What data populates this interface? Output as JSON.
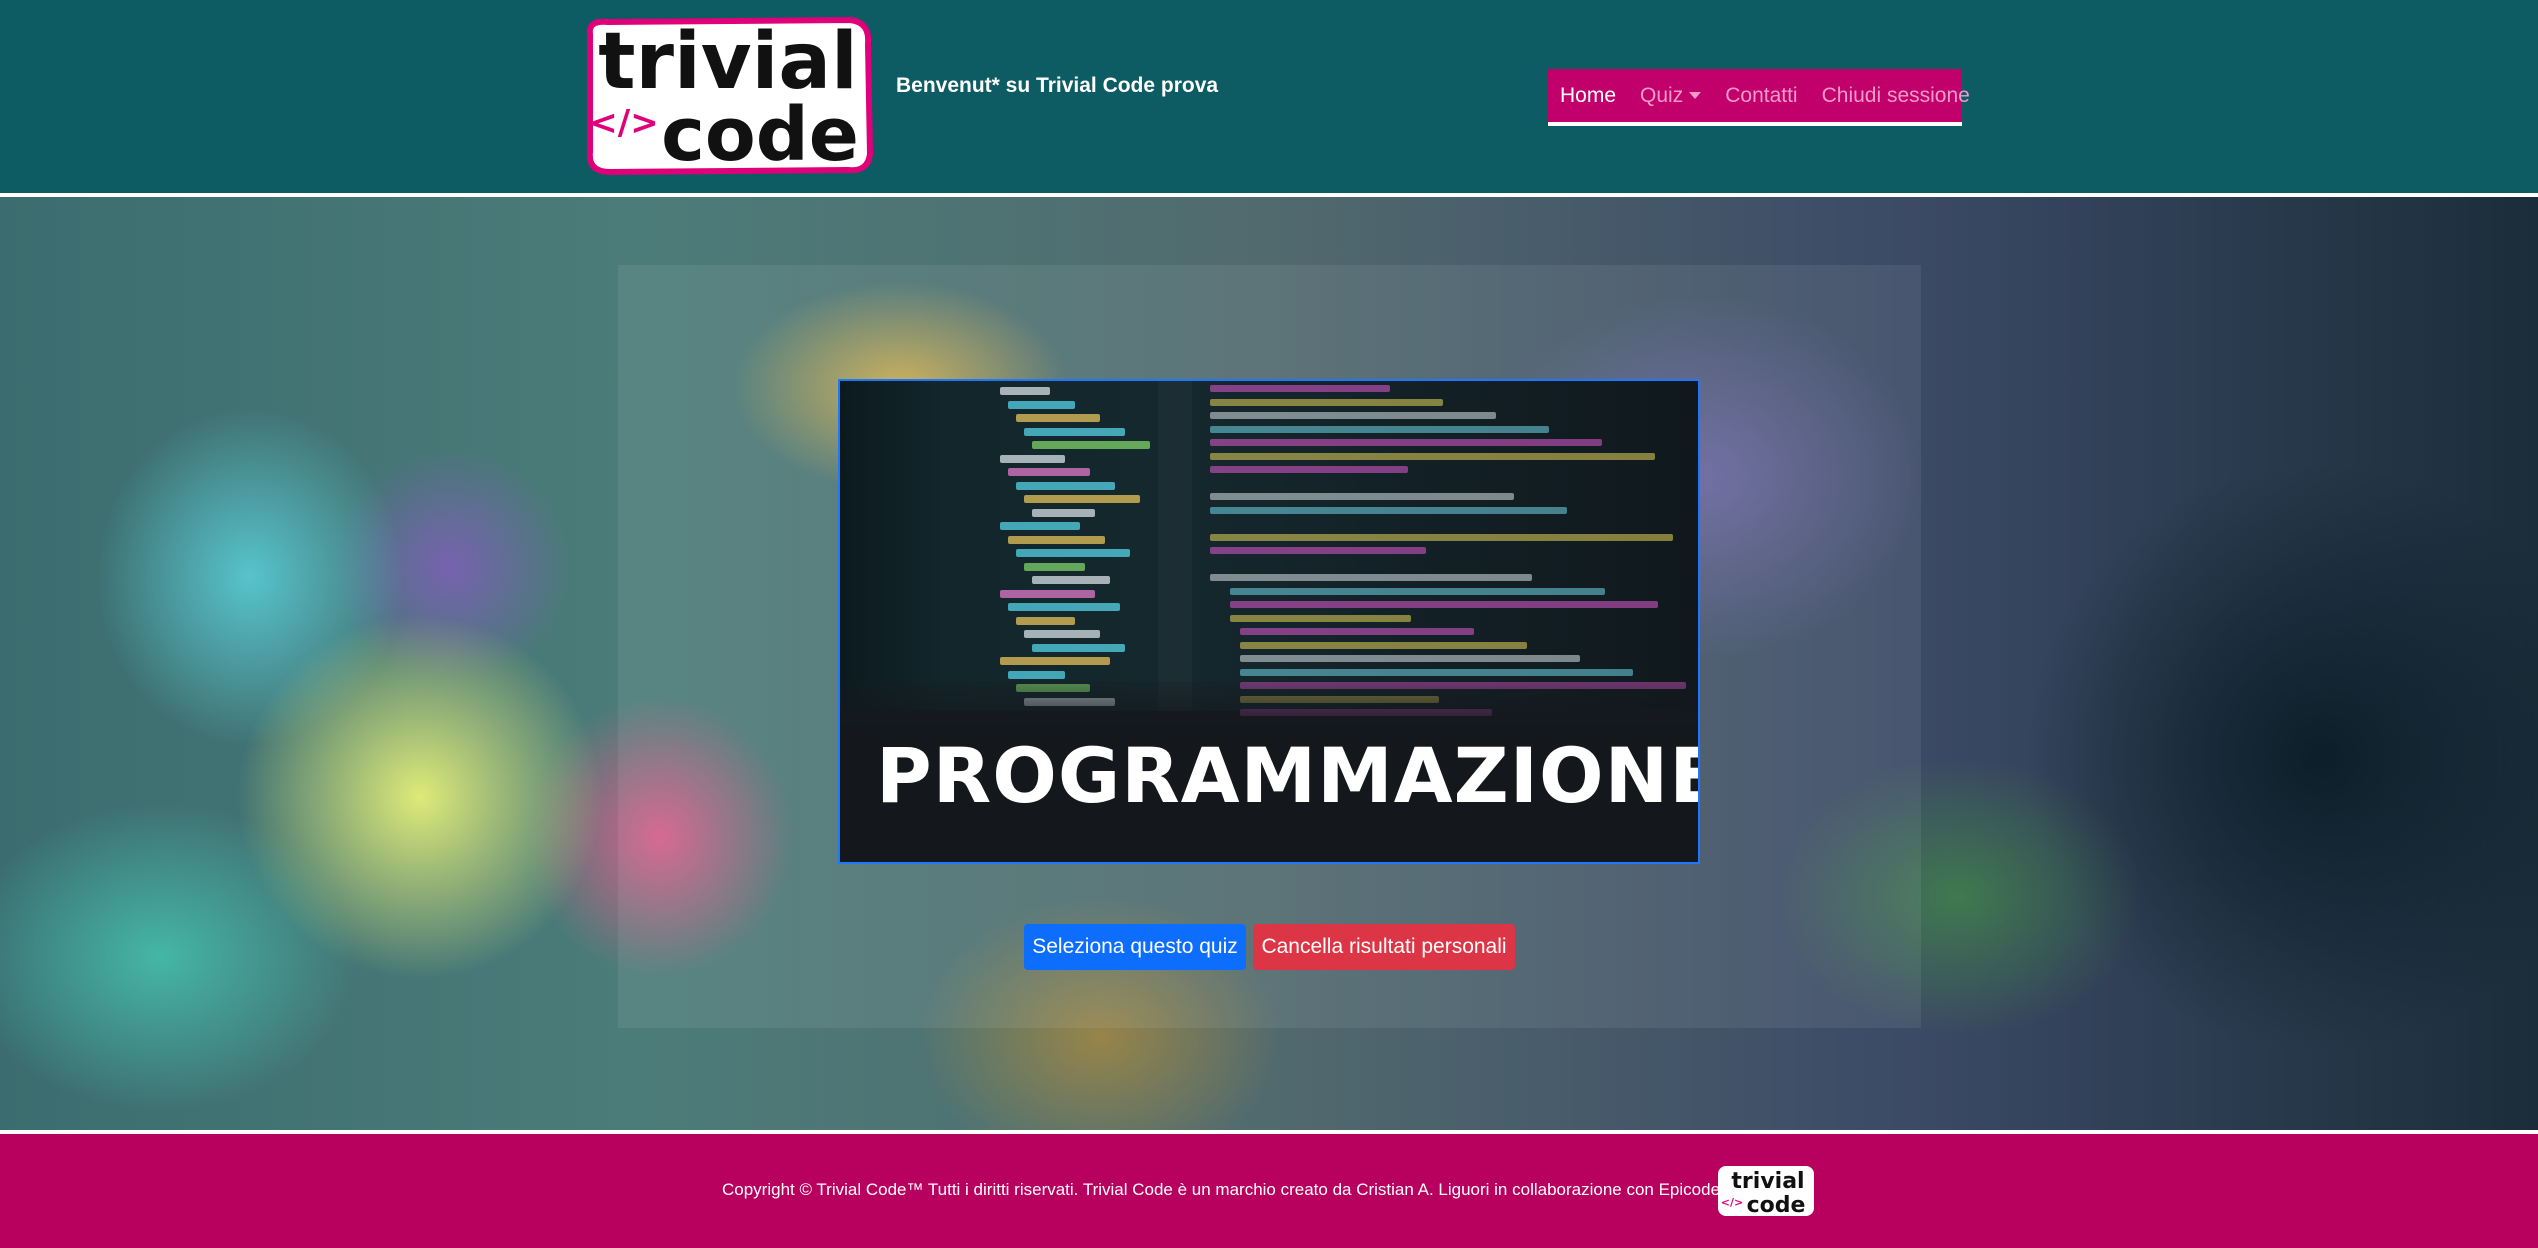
{
  "header": {
    "logo_top": "trivial",
    "logo_bottom": "code",
    "logo_glyph": "</>",
    "welcome": "Benvenut* su Trivial Code prova"
  },
  "nav": {
    "items": [
      {
        "label": "Home",
        "active": true
      },
      {
        "label": "Quiz",
        "dropdown": true
      },
      {
        "label": "Contatti"
      },
      {
        "label": "Chiudi sessione"
      }
    ]
  },
  "quiz": {
    "title": "PROGRAMMAZIONE",
    "select_button": "Seleziona questo quiz",
    "reset_button": "Cancella risultati personali"
  },
  "footer": {
    "copyright": "Copyright © Trivial Code™ Tutti i diritti riservati. Trivial Code è un marchio creato da Cristian A. Liguori in collaborazione con Epicode School."
  },
  "colors": {
    "header_bg": "#0d5b63",
    "nav_bg": "#c1006b",
    "footer_bg": "#b8005f",
    "primary": "#0d6efd",
    "danger": "#dc3545"
  }
}
